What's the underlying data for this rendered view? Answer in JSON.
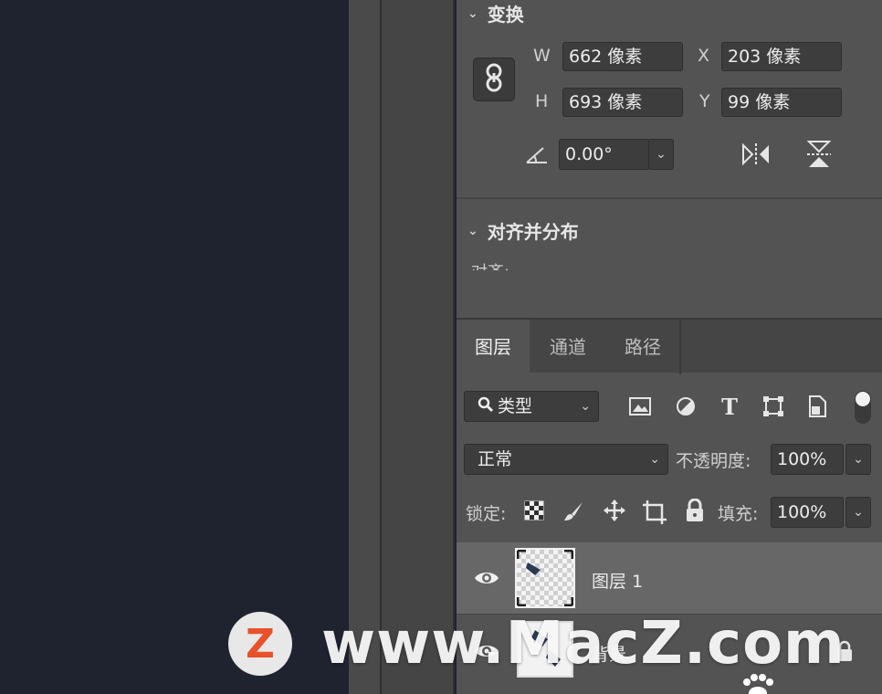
{
  "transform": {
    "title": "变换",
    "w_label": "W",
    "w_value": "662 像素",
    "x_label": "X",
    "x_value": "203 像素",
    "h_label": "H",
    "h_value": "693 像素",
    "y_label": "Y",
    "y_value": "99 像素",
    "angle_value": "0.00°",
    "link_icon": "chain-link-icon",
    "flip_h_icon": "flip-horizontal-icon",
    "flip_v_icon": "flip-vertical-icon"
  },
  "align": {
    "title": "对齐并分布",
    "sub_label": "对齐:"
  },
  "tabs": [
    {
      "label": "图层",
      "active": true
    },
    {
      "label": "通道",
      "active": false
    },
    {
      "label": "路径",
      "active": false
    }
  ],
  "filter": {
    "kind_label": "类型",
    "icons": [
      "image-filter-icon",
      "adjustment-filter-icon",
      "type-filter-icon",
      "shape-filter-icon",
      "smart-object-filter-icon"
    ]
  },
  "blend": {
    "mode": "正常",
    "opacity_label": "不透明度:",
    "opacity_value": "100%"
  },
  "lock": {
    "label": "锁定:",
    "fill_label": "填充:",
    "fill_value": "100%"
  },
  "layers": [
    {
      "name": "图层 1",
      "visible": true,
      "selected": true
    },
    {
      "name": "背景",
      "visible": true,
      "selected": false
    }
  ],
  "watermark": {
    "logo_letter": "Z",
    "text": "www.MacZ.com",
    "accent": "#e8512a"
  },
  "colors": {
    "panel": "#535353",
    "canvas": "#1f2330",
    "field": "#3d3d3d"
  }
}
